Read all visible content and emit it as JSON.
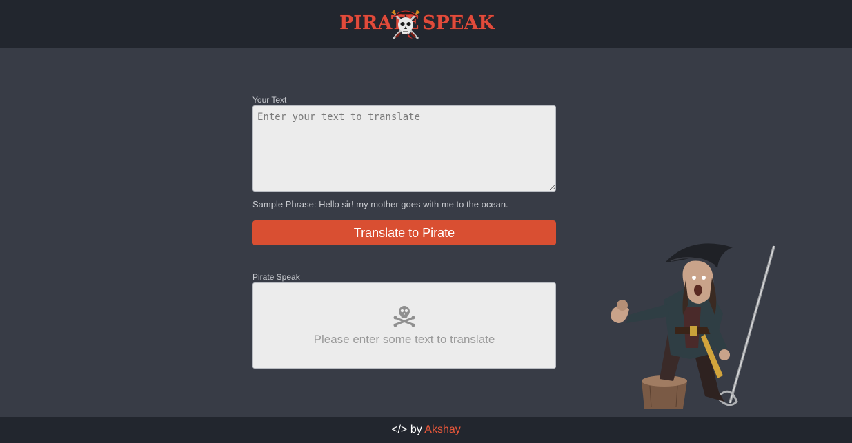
{
  "header": {
    "logo_left": "PIRATE",
    "logo_right": "SPEAK",
    "logo_icon": "skull-crossbones-icon",
    "logo_color": "#e14b3b"
  },
  "input": {
    "label": "Your Text",
    "placeholder": "Enter your text to translate",
    "value": ""
  },
  "sample": {
    "text": "Sample Phrase: Hello sir! my mother goes with me to the ocean."
  },
  "translate_button": {
    "label": "Translate to Pirate",
    "color": "#d94f32"
  },
  "output": {
    "label": "Pirate Speak",
    "icon": "skull-crossbones-icon",
    "placeholder_text": "Please enter some text to translate"
  },
  "footer": {
    "prefix": "</> by",
    "author": "Akshay",
    "author_color": "#e8573a"
  },
  "colors": {
    "header_bg": "#22262e",
    "page_bg": "#383c46",
    "box_bg": "#ececec"
  }
}
